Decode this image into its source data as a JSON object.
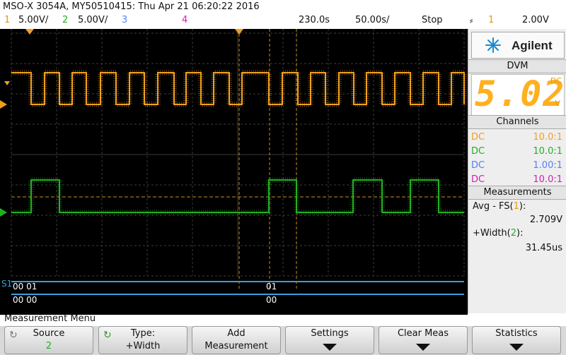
{
  "header": {
    "title": "MSO-X 3054A, MY50510415: Thu Apr 21 06:20:22 2016"
  },
  "status": {
    "ch1_label": "1",
    "ch1_scale": "5.00V/",
    "ch2_label": "2",
    "ch2_scale": "5.00V/",
    "ch3_label": "3",
    "ch4_label": "4",
    "delay": "230.0s",
    "timebase": "50.00s/",
    "run_state": "Stop",
    "trigger_icon": "trigger-edge-icon",
    "trigger_glyph": "⸗",
    "trigger_source": "1",
    "trigger_level": "2.00V"
  },
  "colors": {
    "ch1": "#f0a020",
    "ch2": "#22b022",
    "ch3": "#5080ff",
    "ch4": "#d020b0",
    "bus": "#3aa0e0"
  },
  "bus": {
    "label": "S1",
    "row1_left": "00 01",
    "row1_right": "01",
    "row2_left": "00 00",
    "row2_right": "00"
  },
  "panel": {
    "brand": "Agilent",
    "dvm_title": "DVM",
    "dvm_value": "5.02",
    "dvm_mode": "DC",
    "dvm_unit": "V",
    "channels_title": "Channels",
    "channels": [
      {
        "coupling": "DC",
        "probe": "10.0:1",
        "color": "#f0a020"
      },
      {
        "coupling": "DC",
        "probe": "10.0:1",
        "color": "#22b022"
      },
      {
        "coupling": "DC",
        "probe": "1.00:1",
        "color": "#5080ff"
      },
      {
        "coupling": "DC",
        "probe": "10.0:1",
        "color": "#d020b0"
      }
    ],
    "measurements_title": "Measurements",
    "measurements": [
      {
        "name": "Avg - FS",
        "ch": "1",
        "value": "2.709V"
      },
      {
        "name": "+Width",
        "ch": "2",
        "value": "31.45us"
      }
    ]
  },
  "menu": {
    "title": "Measurement Menu",
    "buttons": [
      {
        "line1": "Source",
        "line2": "2"
      },
      {
        "line1": "Type:",
        "line2": "+Width"
      },
      {
        "line1": "Add",
        "line2": "Measurement"
      },
      {
        "line1": "Settings",
        "line2": ""
      },
      {
        "line1": "Clear Meas",
        "line2": ""
      },
      {
        "line1": "Statistics",
        "line2": ""
      }
    ]
  }
}
